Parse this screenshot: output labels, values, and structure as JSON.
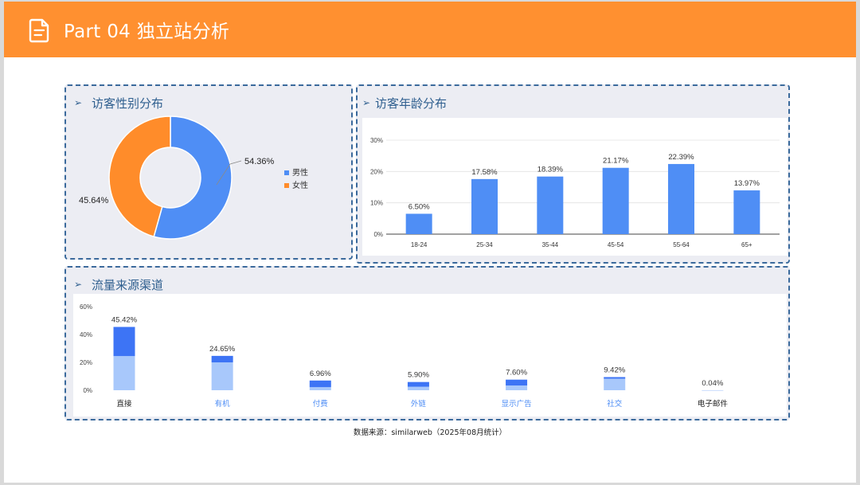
{
  "header": {
    "title": "Part 04 独立站分析"
  },
  "gender": {
    "title": "访客性别分布",
    "chart_data": {
      "type": "pie",
      "variant": "donut",
      "slices": [
        {
          "label": "男性",
          "value": 54.36,
          "display": "54.36%",
          "color": "#4f8ef5"
        },
        {
          "label": "女性",
          "value": 45.64,
          "display": "45.64%",
          "color": "#ff8c2a"
        }
      ],
      "legend": "right"
    }
  },
  "age": {
    "title": "访客年龄分布",
    "chart_data": {
      "type": "bar",
      "categories": [
        "18-24",
        "25-34",
        "35-44",
        "45-54",
        "55-64",
        "65+"
      ],
      "values": [
        6.5,
        17.58,
        18.39,
        21.17,
        22.39,
        13.97
      ],
      "labels": [
        "6.50%",
        "17.58%",
        "18.39%",
        "21.17%",
        "22.39%",
        "13.97%"
      ],
      "yticks": [
        0,
        10,
        20,
        30
      ],
      "ytick_labels": [
        "0%",
        "10%",
        "20%",
        "30%"
      ],
      "ylim": [
        0,
        30
      ],
      "grid": true,
      "color": "#4f8ef5"
    }
  },
  "traffic": {
    "title": "流量来源渠道",
    "chart_data": {
      "type": "bar",
      "stacked": true,
      "categories": [
        "直接",
        "有机",
        "付费",
        "外链",
        "显示广告",
        "社交",
        "电子邮件"
      ],
      "values": [
        45.42,
        24.65,
        6.96,
        5.9,
        7.6,
        9.42,
        0.04
      ],
      "labels": [
        "45.42%",
        "24.65%",
        "6.96%",
        "5.90%",
        "7.60%",
        "9.42%",
        "0.04%"
      ],
      "lower_values": [
        24.5,
        20,
        2.2,
        2.5,
        3.4,
        8.3,
        0.03
      ],
      "category_colors": [
        "#222222",
        "#4f8ef5",
        "#4f8ef5",
        "#4f8ef5",
        "#4f8ef5",
        "#4f8ef5",
        "#222222"
      ],
      "yticks": [
        0,
        20,
        40,
        60
      ],
      "ytick_labels": [
        "0%",
        "20%",
        "40%",
        "60%"
      ],
      "ylim": [
        0,
        60
      ],
      "upper_color": "#3d74f5",
      "lower_color": "#a8c8fb"
    }
  },
  "footer": {
    "source": "数据来源：similarweb（2025年08月统计）"
  }
}
